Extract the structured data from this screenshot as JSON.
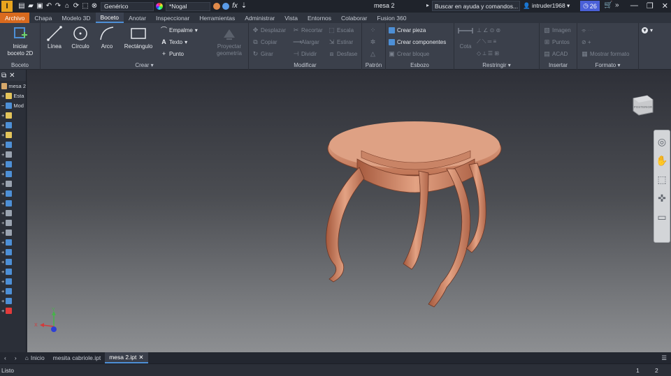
{
  "titlebar": {
    "app_logo": "I",
    "material": "Genérico",
    "appearance": "*Nogal",
    "doc_title": "mesa 2",
    "search_placeholder": "Buscar en ayuda y comandos...",
    "user": "intruder1968",
    "clock_count": "26"
  },
  "tabs": [
    "Archivo",
    "Chapa",
    "Modelo 3D",
    "Boceto",
    "Anotar",
    "Inspeccionar",
    "Herramientas",
    "Administrar",
    "Vista",
    "Entornos",
    "Colaborar",
    "Fusion 360"
  ],
  "active_tab": "Boceto",
  "ribbon": {
    "boceto": {
      "title": "Boceto",
      "start_label_1": "Iniciar",
      "start_label_2": "boceto 2D"
    },
    "crear": {
      "title": "Crear",
      "linea": "Línea",
      "circulo": "Círculo",
      "arco": "Arco",
      "rectangulo": "Rectángulo",
      "empalme": "Empalme",
      "texto": "Texto",
      "punto": "Punto",
      "proyectar_1": "Proyectar",
      "proyectar_2": "geometría"
    },
    "modificar": {
      "title": "Modificar",
      "desplazar": "Desplazar",
      "copiar": "Copiar",
      "girar": "Girar",
      "recortar": "Recortar",
      "alargar": "Alargar",
      "dividir": "Dividir",
      "escala": "Escala",
      "estirar": "Estirar",
      "desfase": "Desfase"
    },
    "patron": {
      "title": "Patrón"
    },
    "esbozo": {
      "title": "Esbozo",
      "crear_pieza": "Crear pieza",
      "crear_componentes": "Crear componentes",
      "crear_bloque": "Crear bloque"
    },
    "restringir": {
      "title": "Restringir",
      "cota": "Cota"
    },
    "insertar": {
      "title": "Insertar",
      "imagen": "Imagen",
      "puntos": "Puntos",
      "acad": "ACAD"
    },
    "formato": {
      "title": "Formato",
      "mostrar_formato": "Mostrar formato"
    }
  },
  "browser": {
    "rows": [
      "mesa 2",
      "Esta",
      "Mod"
    ]
  },
  "viewcube_label": "POSTERIOR",
  "triad": {
    "x": "X",
    "y": "Y"
  },
  "doc_tabs": [
    "Inicio",
    "mesita cabriole.ipt",
    "mesa 2.ipt"
  ],
  "active_doc_tab": "mesa 2.ipt",
  "status": {
    "text": "Listo",
    "num1": "1",
    "num2": "2"
  },
  "colors": {
    "accent_blue": "#4d8fd6",
    "file_tab": "#d96a1e",
    "table_wood": "#d3906e"
  }
}
